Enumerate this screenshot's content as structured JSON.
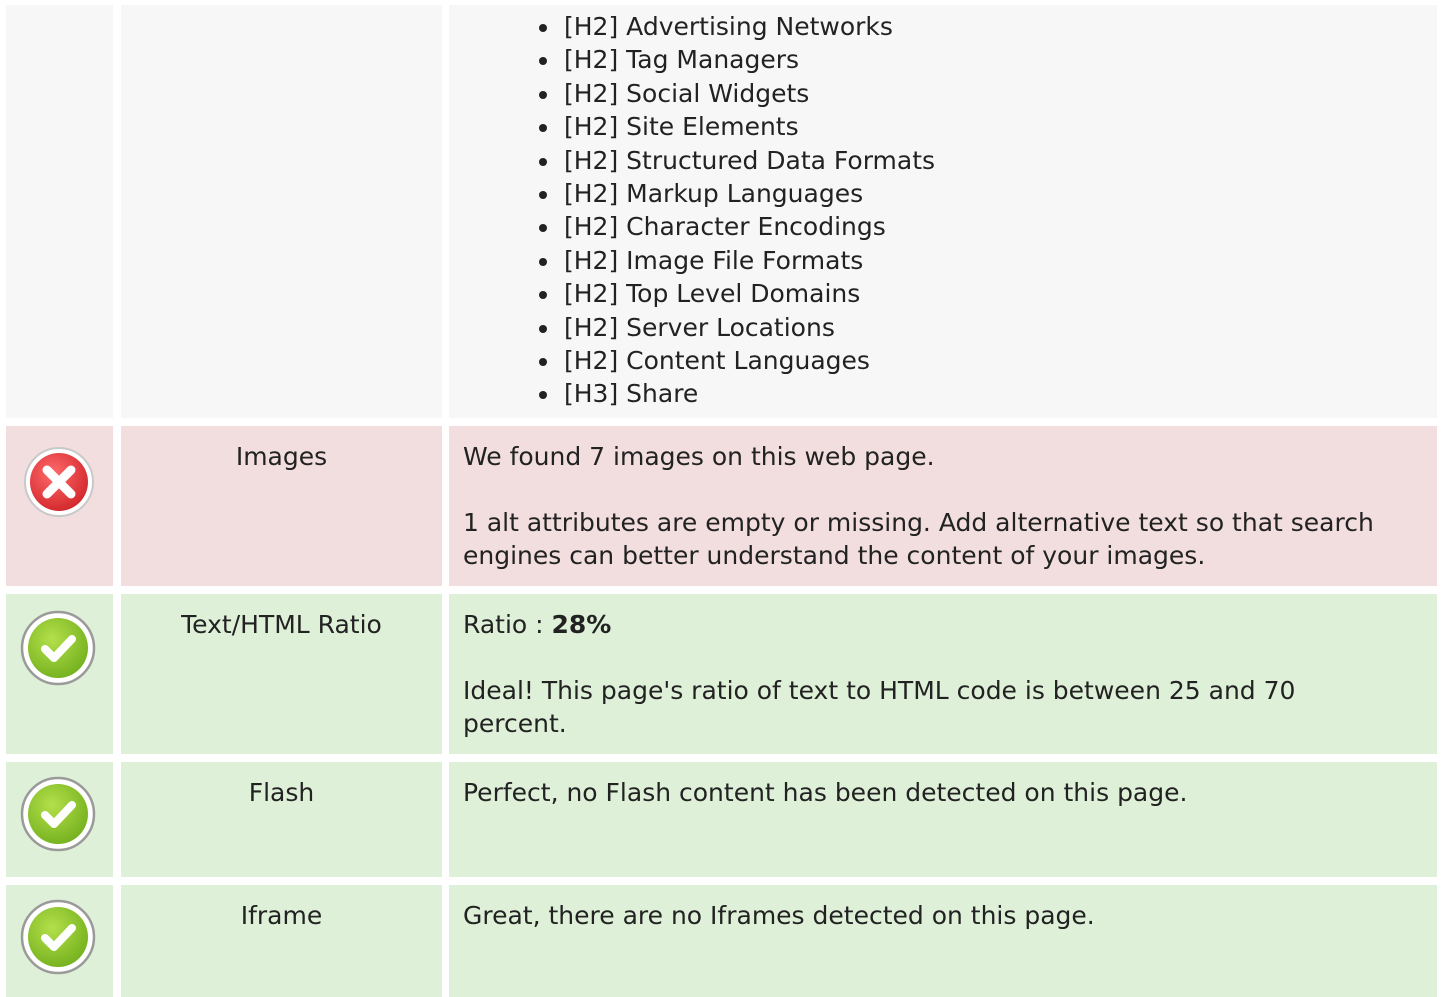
{
  "heading_list": {
    "items": [
      "[H2] Advertising Networks",
      "[H2] Tag Managers",
      "[H2] Social Widgets",
      "[H2] Site Elements",
      "[H2] Structured Data Formats",
      "[H2] Markup Languages",
      "[H2] Character Encodings",
      "[H2] Image File Formats",
      "[H2] Top Level Domains",
      "[H2] Server Locations",
      "[H2] Content Languages",
      "[H3] Share"
    ]
  },
  "checks": {
    "images": {
      "status": "error",
      "icon": "error-x-icon",
      "name": "Images",
      "line1": "We found 7 images on this web page.",
      "line2": "1 alt attributes are empty or missing. Add alternative text so that search engines can better understand the content of your images."
    },
    "ratio": {
      "status": "ok",
      "icon": "check-icon",
      "name": "Text/HTML Ratio",
      "label": "Ratio : ",
      "value": "28%",
      "line2": "Ideal! This page's ratio of text to HTML code is between 25 and 70 percent."
    },
    "flash": {
      "status": "ok",
      "icon": "check-icon",
      "name": "Flash",
      "line1": "Perfect, no Flash content has been detected on this page."
    },
    "iframe": {
      "status": "ok",
      "icon": "check-icon",
      "name": "Iframe",
      "line1": "Great, there are no Iframes detected on this page."
    }
  },
  "colors": {
    "neutral_bg": "#f7f7f7",
    "error_bg": "#f2dede",
    "ok_bg": "#dff0d8",
    "error_icon": "#e0393b",
    "ok_icon": "#8cc62d"
  }
}
